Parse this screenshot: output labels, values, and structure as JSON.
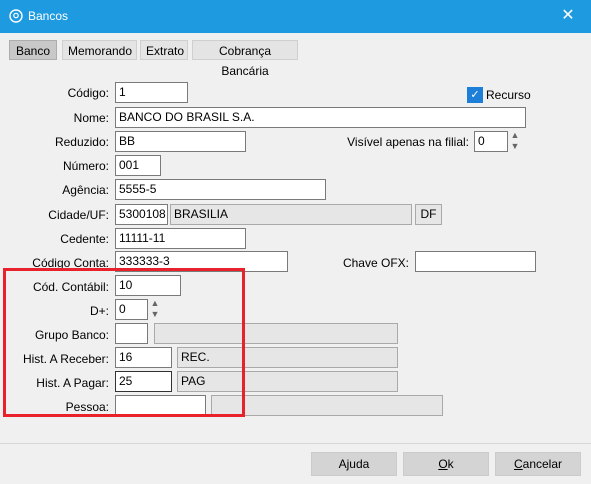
{
  "window": {
    "title": "Bancos",
    "close_symbol": "✕"
  },
  "tabs": [
    {
      "label": "Banco"
    },
    {
      "label": "Memorando"
    },
    {
      "label": "Extrato"
    },
    {
      "label": "Cobrança Bancária"
    }
  ],
  "form": {
    "codigo": {
      "label": "Código:",
      "value": "1"
    },
    "recurso": {
      "label": "Recurso",
      "checked": true
    },
    "nome": {
      "label": "Nome:",
      "value": "BANCO DO BRASIL S.A."
    },
    "reduzido": {
      "label": "Reduzido:",
      "value": "BB"
    },
    "visivel_filial": {
      "label": "Visível apenas na filial:",
      "value": "0"
    },
    "numero": {
      "label": "Número:",
      "value": "001"
    },
    "agencia": {
      "label": "Agência:",
      "value": "5555-5"
    },
    "cidade_uf": {
      "label": "Cidade/UF:",
      "codigo": "5300108",
      "cidade": "BRASILIA",
      "uf": "DF"
    },
    "cedente": {
      "label": "Cedente:",
      "value": "11111-11"
    },
    "codigo_conta": {
      "label": "Código Conta:",
      "value": "333333-3"
    },
    "chave_ofx": {
      "label": "Chave OFX:",
      "value": ""
    },
    "cod_contabil": {
      "label": "Cód. Contábil:",
      "value": "10"
    },
    "d_plus": {
      "label": "D+:",
      "value": "0"
    },
    "grupo_banco": {
      "label": "Grupo Banco:",
      "codigo": "",
      "descricao": ""
    },
    "hist_receber": {
      "label": "Hist. A Receber:",
      "codigo": "16",
      "descricao": "REC."
    },
    "hist_pagar": {
      "label": "Hist. A Pagar:",
      "codigo": "25",
      "descricao": "PAG"
    },
    "pessoa": {
      "label": "Pessoa:",
      "codigo": "",
      "descricao": ""
    }
  },
  "footer": {
    "ajuda": "Ajuda",
    "ok_under": "O",
    "ok_rest": "k",
    "cancelar_under": "C",
    "cancelar_rest": "ancelar"
  },
  "colors": {
    "titlebar": "#1e9be0",
    "highlight_box": "#e8212b",
    "checkbox": "#1e7fd8"
  }
}
